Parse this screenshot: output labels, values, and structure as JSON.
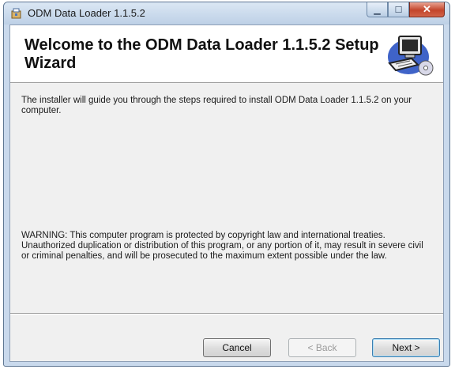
{
  "window": {
    "title": "ODM Data Loader 1.1.5.2"
  },
  "caption_buttons": {
    "minimize_glyph": "▁",
    "maximize_glyph": "☐",
    "close_glyph": "✕"
  },
  "banner": {
    "title": "Welcome to the ODM Data Loader 1.1.5.2 Setup Wizard",
    "icon": "computer-setup-icon"
  },
  "content": {
    "intro": "The installer will guide you through the steps required to install ODM Data Loader 1.1.5.2 on your computer.",
    "warning": "WARNING: This computer program is protected by copyright law and international treaties. Unauthorized duplication or distribution of this program, or any portion of it, may result in severe civil or criminal penalties, and will be prosecuted to the maximum extent possible under the law."
  },
  "buttons": {
    "cancel": "Cancel",
    "back": "< Back",
    "next": "Next >"
  },
  "colors": {
    "titlebar": "#c9d9ec",
    "close_button": "#c3452b",
    "client_background": "#f0f0f0",
    "default_button_border": "#3c7fb1"
  }
}
